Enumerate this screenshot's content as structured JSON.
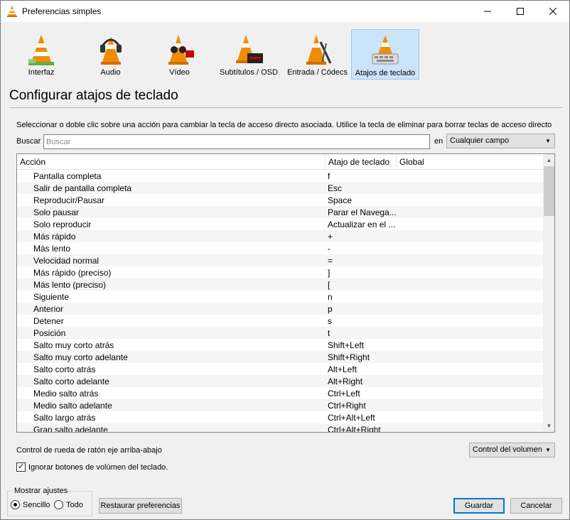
{
  "window": {
    "title": "Preferencias simples"
  },
  "toolbar": {
    "items": [
      {
        "label": "Interfaz"
      },
      {
        "label": "Audio"
      },
      {
        "label": "Vídeo"
      },
      {
        "label": "Subtítulos / OSD"
      },
      {
        "label": "Entrada / Códecs"
      },
      {
        "label": "Atajos de teclado"
      }
    ]
  },
  "page": {
    "heading": "Configurar atajos de teclado",
    "description": "Seleccionar o doble clic sobre una acción para cambiar la tecla de acceso directo asociada. Utilice la tecla de eliminar para borrar teclas de acceso directo"
  },
  "search": {
    "label": "Buscar",
    "placeholder": "Buscar",
    "value": "",
    "in_label": "en",
    "field_value": "Cualquier campo"
  },
  "table": {
    "columns": [
      "Acción",
      "Atajo de teclado",
      "Global"
    ],
    "rows": [
      {
        "action": "Pantalla completa",
        "key": "f"
      },
      {
        "action": "Salir de pantalla completa",
        "key": "Esc"
      },
      {
        "action": "Reproducir/Pausar",
        "key": "Space"
      },
      {
        "action": "Solo pausar",
        "key": "Parar el Navega..."
      },
      {
        "action": "Solo reproducir",
        "key": "Actualizar en el ..."
      },
      {
        "action": "Más rápido",
        "key": "+"
      },
      {
        "action": "Más lento",
        "key": "-"
      },
      {
        "action": "Velocidad normal",
        "key": "="
      },
      {
        "action": "Más rápido (preciso)",
        "key": "]"
      },
      {
        "action": "Más lento (preciso)",
        "key": "["
      },
      {
        "action": "Siguiente",
        "key": "n"
      },
      {
        "action": "Anterior",
        "key": "p"
      },
      {
        "action": "Detener",
        "key": "s"
      },
      {
        "action": "Posición",
        "key": "t"
      },
      {
        "action": "Salto muy corto atrás",
        "key": "Shift+Left"
      },
      {
        "action": "Salto muy corto adelante",
        "key": "Shift+Right"
      },
      {
        "action": "Salto corto atrás",
        "key": "Alt+Left"
      },
      {
        "action": "Salto corto adelante",
        "key": "Alt+Right"
      },
      {
        "action": "Medio salto atrás",
        "key": "Ctrl+Left"
      },
      {
        "action": "Medio salto adelante",
        "key": "Ctrl+Right"
      },
      {
        "action": "Salto largo atrás",
        "key": "Ctrl+Alt+Left"
      },
      {
        "action": "Gran salto adelante",
        "key": "Ctrl+Alt+Right"
      }
    ]
  },
  "wheel": {
    "label": "Control de rueda de ratón eje arriba-abajo",
    "value": "Control del volumen"
  },
  "ignore_volume": {
    "label": "Ignorar botones de volúmen del teclado.",
    "checked": true
  },
  "show_settings": {
    "title": "Mostrar ajustes",
    "simple": "Sencillo",
    "all": "Todo"
  },
  "buttons": {
    "reset": "Restaurar preferencias",
    "save": "Guardar",
    "cancel": "Cancelar"
  },
  "colors": {
    "accent": "#0078d7",
    "selected_bg": "#cce4f7",
    "cone_orange": "#f08c00"
  }
}
